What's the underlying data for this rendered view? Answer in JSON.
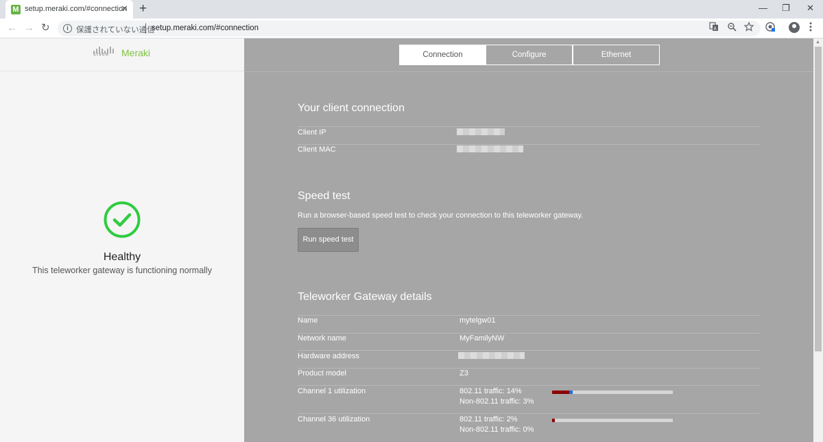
{
  "browser": {
    "tab_title": "setup.meraki.com/#connection",
    "favicon_letter": "M",
    "tab_close": "✕",
    "new_tab": "+",
    "window_controls": {
      "minimize": "—",
      "maximize": "❐",
      "close": "✕"
    },
    "nav": {
      "back": "←",
      "forward": "→",
      "reload": "↻"
    },
    "security_text": "保護されていない通信",
    "url": "setup.meraki.com/#connection",
    "icons": [
      "translate-icon",
      "zoom-icon",
      "bookmark-star-icon",
      "extension-icon",
      "profile-avatar-icon",
      "menu-dots-icon"
    ]
  },
  "brand": {
    "cisco": "cisco",
    "meraki": "Meraki",
    "meraki_color": "#7fc242"
  },
  "status": {
    "title": "Healthy",
    "description": "This teleworker gateway is functioning normally",
    "color": "#2ecc40"
  },
  "tabs": [
    {
      "label": "Connection",
      "active": true
    },
    {
      "label": "Configure",
      "active": false
    },
    {
      "label": "Ethernet",
      "active": false
    }
  ],
  "client": {
    "title": "Your client connection",
    "rows": [
      {
        "label": "Client IP"
      },
      {
        "label": "Client MAC"
      }
    ]
  },
  "speed_test": {
    "title": "Speed test",
    "description": "Run a browser-based speed test to check your connection to this teleworker gateway.",
    "button": "Run speed test"
  },
  "gateway": {
    "title": "Teleworker Gateway details",
    "rows": [
      {
        "label": "Name",
        "value": "mytelgw01"
      },
      {
        "label": "Network name",
        "value": "MyFamilyNW"
      },
      {
        "label": "Hardware address"
      },
      {
        "label": "Product model",
        "value": "Z3"
      }
    ],
    "channels": [
      {
        "label": "Channel 1 utilization",
        "wifi": "802.11 traffic: 14%",
        "non_wifi": "Non-802.11 traffic: 3%",
        "wifi_fraction": 0.14,
        "non_wifi_fraction": 0.03
      },
      {
        "label": "Channel 36 utilization",
        "wifi": "802.11 traffic: 2%",
        "non_wifi": "Non-802.11 traffic: 0%",
        "wifi_fraction": 0.02,
        "non_wifi_fraction": 0.0
      }
    ],
    "bar_colors": {
      "wifi": "#8b0000",
      "non_wifi": "#1f6fd6"
    }
  }
}
